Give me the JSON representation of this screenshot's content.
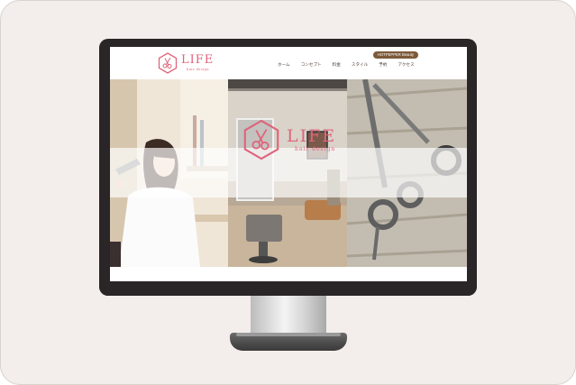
{
  "site": {
    "logo_text": "LIFE",
    "logo_sub": "hair design"
  },
  "header": {
    "booking_label": "HOTPEPPER Beauty"
  },
  "nav": {
    "items": [
      {
        "label": "ホーム"
      },
      {
        "label": "コンセプト"
      },
      {
        "label": "料金"
      },
      {
        "label": "スタイル"
      },
      {
        "label": "予約"
      },
      {
        "label": "アクセス"
      }
    ]
  },
  "hero": {
    "logo_text": "LIFE",
    "logo_sub": "hair design"
  },
  "colors": {
    "accent": "#e0637a",
    "button": "#7d5a3a",
    "bezel": "#2a2526",
    "background": "#f3eeeb"
  },
  "icons": [
    "scissors-hexagon-logo-icon"
  ]
}
